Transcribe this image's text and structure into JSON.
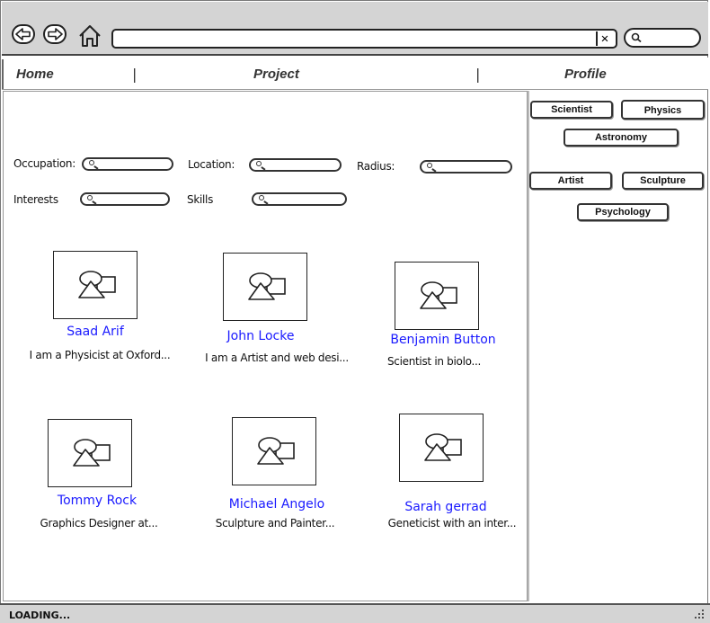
{
  "menu": {
    "items": [
      {
        "label": "Home"
      },
      {
        "label": "Project"
      },
      {
        "label": "Profile"
      }
    ],
    "separator": "|"
  },
  "filters": {
    "occupation_label": "Occupation:",
    "location_label": "Location:",
    "radius_label": "Radius:",
    "interests_label": "Interests",
    "skills_label": "Skills"
  },
  "profiles": [
    {
      "name": "Saad Arif",
      "desc": "I am a Physicist at Oxford..."
    },
    {
      "name": "John Locke",
      "desc": "I am a Artist and web desi..."
    },
    {
      "name": "Benjamin Button",
      "desc": "Scientist in biolo..."
    },
    {
      "name": "Tommy Rock",
      "desc": "Graphics Designer at..."
    },
    {
      "name": "Michael Angelo",
      "desc": "Sculpture and Painter..."
    },
    {
      "name": "Sarah gerrad",
      "desc": "Geneticist with an inter..."
    }
  ],
  "tags": [
    {
      "label": "Scientist"
    },
    {
      "label": "Physics"
    },
    {
      "label": "Astronomy"
    },
    {
      "label": "Artist"
    },
    {
      "label": "Sculpture"
    },
    {
      "label": "Psychology"
    }
  ],
  "status": {
    "text": "LOADING..."
  },
  "icons": {
    "back": "back-arrow-icon",
    "forward": "forward-arrow-icon",
    "home": "home-icon",
    "clear": "close-icon",
    "search": "search-icon",
    "image": "image-placeholder-icon",
    "grip": "resize-grip-icon"
  }
}
